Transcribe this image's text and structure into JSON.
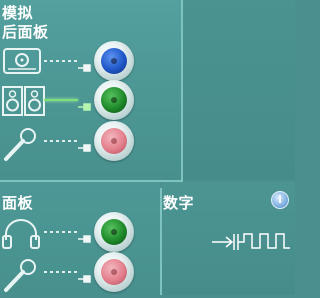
{
  "analog": {
    "title": "模拟",
    "rear_panel": {
      "title": "后面板"
    },
    "front_panel": {
      "title": "面板"
    }
  },
  "digital": {
    "title": "数字",
    "info_icon": "info-icon"
  },
  "rear_jacks": [
    {
      "device": "line-in-icon",
      "color": "#1f57c8",
      "connected": false
    },
    {
      "device": "speakers-icon",
      "color": "#1f8a2a",
      "connected": true
    },
    {
      "device": "microphone-icon",
      "color": "#e37f8c",
      "connected": false
    }
  ],
  "front_jacks": [
    {
      "device": "headphones-icon",
      "color": "#1f8a2a",
      "connected": false
    },
    {
      "device": "microphone-icon",
      "color": "#e37f8c",
      "connected": false
    }
  ],
  "colors": {
    "background": "#4b8f8e",
    "divider": "#7ec3c0",
    "active_cable": "#7ee07a"
  }
}
